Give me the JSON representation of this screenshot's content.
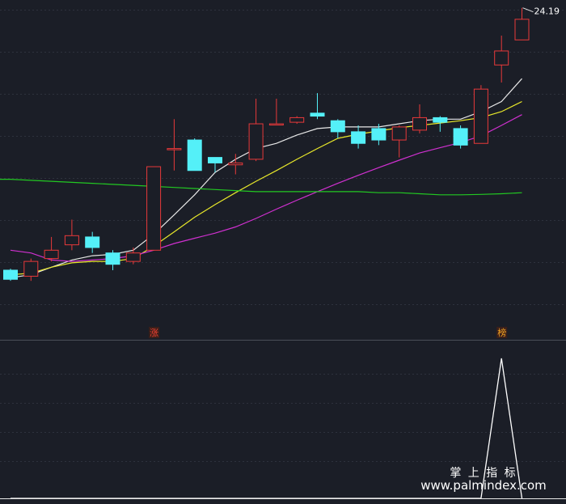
{
  "chart_data": [
    {
      "type": "candlestick",
      "panel": "price",
      "ylim": [
        7.0,
        24.6
      ],
      "y_scale": "log",
      "grid": true,
      "max_label": "24.19",
      "badges": [
        {
          "index": 7,
          "text": "涨",
          "color": "#f04030"
        },
        {
          "index": 24,
          "text": "榜",
          "color": "#f0a020"
        }
      ],
      "candles": [
        {
          "open": 7.6,
          "close": 7.3,
          "high": 7.65,
          "low": 7.25
        },
        {
          "open": 7.4,
          "close": 7.9,
          "high": 8.0,
          "low": 7.25
        },
        {
          "open": 8.0,
          "close": 8.3,
          "high": 8.8,
          "low": 7.9
        },
        {
          "open": 8.5,
          "close": 8.85,
          "high": 9.5,
          "low": 8.3
        },
        {
          "open": 8.8,
          "close": 8.4,
          "high": 9.0,
          "low": 8.2
        },
        {
          "open": 8.2,
          "close": 7.8,
          "high": 8.3,
          "low": 7.6
        },
        {
          "open": 7.9,
          "close": 8.2,
          "high": 8.4,
          "low": 7.8
        },
        {
          "open": 8.3,
          "close": 12.0,
          "high": 12.0,
          "low": 8.3
        },
        {
          "open": 13.0,
          "close": 13.0,
          "high": 14.8,
          "low": 11.8
        },
        {
          "open": 13.5,
          "close": 11.8,
          "high": 13.6,
          "low": 11.8
        },
        {
          "open": 12.5,
          "close": 12.2,
          "high": 12.5,
          "low": 11.7
        },
        {
          "open": 12.1,
          "close": 12.2,
          "high": 12.7,
          "low": 11.6
        },
        {
          "open": 12.4,
          "close": 14.5,
          "high": 16.2,
          "low": 12.3
        },
        {
          "open": 14.5,
          "close": 14.5,
          "high": 16.2,
          "low": 14.4
        },
        {
          "open": 14.6,
          "close": 14.9,
          "high": 15.0,
          "low": 14.5
        },
        {
          "open": 15.2,
          "close": 15.0,
          "high": 16.6,
          "low": 14.8
        },
        {
          "open": 14.7,
          "close": 14.0,
          "high": 14.8,
          "low": 13.6
        },
        {
          "open": 14.0,
          "close": 13.3,
          "high": 14.4,
          "low": 13.0
        },
        {
          "open": 14.2,
          "close": 13.5,
          "high": 14.5,
          "low": 13.2
        },
        {
          "open": 13.5,
          "close": 14.3,
          "high": 14.4,
          "low": 12.5
        },
        {
          "open": 14.1,
          "close": 14.9,
          "high": 15.8,
          "low": 13.9
        },
        {
          "open": 14.9,
          "close": 14.6,
          "high": 15.0,
          "low": 14.0
        },
        {
          "open": 14.2,
          "close": 13.2,
          "high": 14.4,
          "low": 13.0
        },
        {
          "open": 13.3,
          "close": 16.9,
          "high": 17.2,
          "low": 13.3
        },
        {
          "open": 18.8,
          "close": 20.0,
          "high": 21.4,
          "low": 17.4
        },
        {
          "open": 21.0,
          "close": 23.0,
          "high": 24.19,
          "low": 21.0
        }
      ],
      "series": [
        {
          "color": "#e8e8e8",
          "values": [
            7.35,
            7.45,
            7.7,
            7.95,
            8.1,
            8.15,
            8.3,
            8.9,
            9.7,
            10.6,
            11.7,
            12.4,
            13.0,
            13.3,
            13.8,
            14.2,
            14.3,
            14.3,
            14.3,
            14.5,
            14.7,
            14.8,
            14.8,
            15.3,
            16.0,
            17.7
          ]
        },
        {
          "color": "#e8e82a",
          "values": [
            7.45,
            7.5,
            7.7,
            7.85,
            7.9,
            7.9,
            8.0,
            8.45,
            9.0,
            9.6,
            10.15,
            10.7,
            11.25,
            11.8,
            12.4,
            13.0,
            13.6,
            13.85,
            14.05,
            14.25,
            14.4,
            14.55,
            14.7,
            14.9,
            15.3,
            16.0
          ]
        },
        {
          "color": "#d030d0",
          "values": [
            8.3,
            8.2,
            7.95,
            7.9,
            7.95,
            8.0,
            8.1,
            8.3,
            8.55,
            8.75,
            8.95,
            9.2,
            9.55,
            9.95,
            10.35,
            10.75,
            11.15,
            11.55,
            11.95,
            12.35,
            12.75,
            13.05,
            13.35,
            13.75,
            14.4,
            15.1
          ]
        },
        {
          "color": "#22c822",
          "values": [
            11.35,
            11.3,
            11.25,
            11.2,
            11.15,
            11.1,
            11.05,
            11.0,
            10.95,
            10.9,
            10.85,
            10.8,
            10.75,
            10.75,
            10.75,
            10.75,
            10.75,
            10.75,
            10.7,
            10.7,
            10.65,
            10.6,
            10.6,
            10.62,
            10.65,
            10.7
          ]
        }
      ]
    },
    {
      "type": "line",
      "panel": "indicator",
      "ylim": [
        0,
        1
      ],
      "grid": true,
      "series": [
        {
          "color": "#ffffff",
          "values": [
            0,
            0,
            0,
            0,
            0,
            0,
            0,
            0,
            0,
            0,
            0,
            0,
            0,
            0,
            0,
            0,
            0,
            0,
            0,
            0,
            0,
            0,
            0,
            0,
            1,
            0
          ]
        }
      ]
    }
  ],
  "watermark": {
    "line1": "掌 上 指 标",
    "line2": "www.palmindex.com"
  }
}
